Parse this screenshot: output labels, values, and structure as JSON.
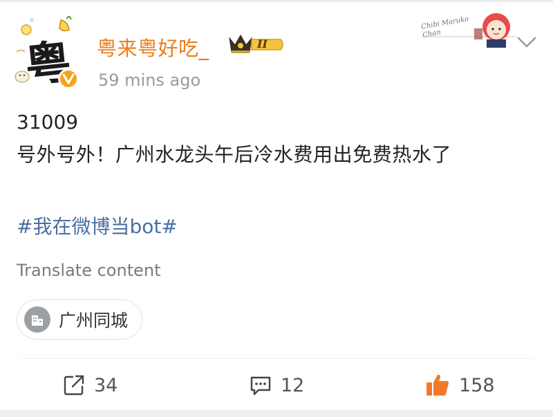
{
  "post": {
    "username": "粤来粤好吃_",
    "member_badge": "II",
    "timestamp": "59 mins ago",
    "avatar_glyph": "粤",
    "post_id": "31009",
    "text": "号外号外！广州水龙头午后冷水费用出免费热水了",
    "hashtag": "#我在微博当bot#",
    "translate_label": "Translate content",
    "location": "广州同城",
    "decoration_text": "Chibi Maruko Chan"
  },
  "actions": {
    "repost_count": "34",
    "comment_count": "12",
    "like_count": "158"
  },
  "colors": {
    "username": "#ea7d1a",
    "hashtag": "#4a6fa1",
    "like_accent": "#f07a2a",
    "verified_badge": "#f7a21b"
  }
}
